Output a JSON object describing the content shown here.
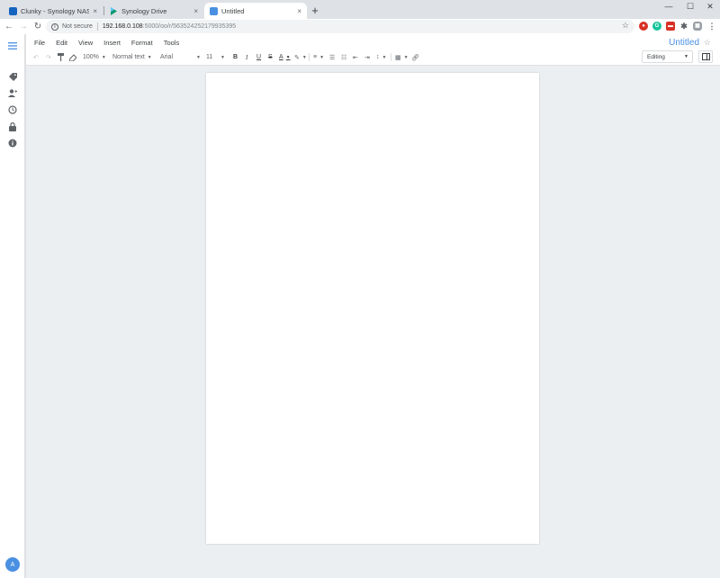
{
  "browser": {
    "tabs": [
      {
        "title": "Clunky - Synology NAS",
        "close": "×",
        "favicon_color": "#1565c0"
      },
      {
        "title": "Synology Drive",
        "close": "×",
        "favicon_color": "#0c9a6e"
      },
      {
        "title": "Untitled",
        "close": "×",
        "favicon_color": "#4a90e2"
      }
    ],
    "new_tab": "+",
    "window_controls": {
      "minimize": "—",
      "maximize": "☐",
      "close": "✕"
    },
    "address": {
      "security": "Not secure",
      "host": "192.168.0.108",
      "path": ":5000/oo/r/563524252179935395"
    }
  },
  "app": {
    "menu": [
      "File",
      "Edit",
      "View",
      "Insert",
      "Format",
      "Tools"
    ],
    "doc_title": "Untitled",
    "toolbar": {
      "zoom": "100%",
      "style": "Normal text",
      "font": "Arial",
      "size": "11",
      "bold": "B",
      "italic": "I",
      "underline": "U",
      "strike": "S",
      "text_color": "A"
    },
    "mode": "Editing",
    "avatar_initial": "A"
  },
  "colors": {
    "accent": "#4a90e2"
  }
}
